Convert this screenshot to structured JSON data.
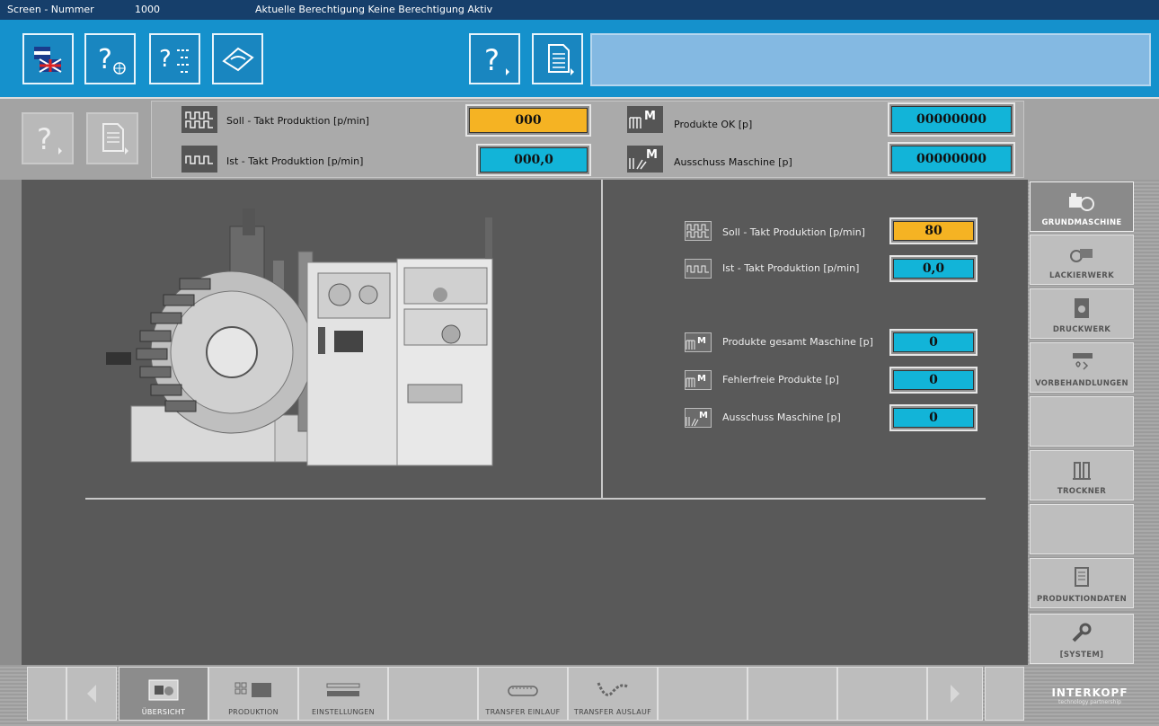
{
  "titlebar": {
    "screen_label": "Screen - Nummer",
    "screen_number": "1000",
    "auth_text": "Aktuelle Berechtigung Keine Berechtigung Aktiv"
  },
  "status": {
    "soll_label": "Soll - Takt Produktion [p/min]",
    "soll_value": "000",
    "ist_label": "Ist - Takt Produktion [p/min]",
    "ist_value": "000,0",
    "ok_label": "Produkte OK [p]",
    "ok_value": "00000000",
    "ausschuss_label": "Ausschuss Maschine [p]",
    "ausschuss_value": "00000000"
  },
  "machine_panel": {
    "soll_label": "Soll - Takt Produktion [p/min]",
    "soll_value": "80",
    "ist_label": "Ist - Takt Produktion [p/min]",
    "ist_value": "0,0",
    "gesamt_label": "Produkte gesamt Maschine [p]",
    "gesamt_value": "0",
    "fehlerfrei_label": "Fehlerfreie Produkte [p]",
    "fehlerfrei_value": "0",
    "ausschuss_label": "Ausschuss Maschine [p]",
    "ausschuss_value": "0"
  },
  "sidenav": [
    {
      "label": "GRUNDMASCHINE",
      "icon": "machine-icon",
      "active": true
    },
    {
      "label": "LACKIERWERK",
      "icon": "coating-icon"
    },
    {
      "label": "DRUCKWERK",
      "icon": "print-icon"
    },
    {
      "label": "VORBEHANDLUNGEN",
      "icon": "pretreatment-icon"
    },
    {
      "label": "",
      "icon": ""
    },
    {
      "label": "TROCKNER",
      "icon": "dryer-icon"
    },
    {
      "label": "",
      "icon": ""
    },
    {
      "label": "PRODUKTIONDATEN",
      "icon": "document-icon"
    },
    {
      "label": "[SYSTEM]",
      "icon": "wrench-icon"
    }
  ],
  "bottomnav": [
    {
      "label": "ÜBERSICHT",
      "icon": "overview-icon",
      "active": true
    },
    {
      "label": "PRODUKTION",
      "icon": "production-icon"
    },
    {
      "label": "EINSTELLUNGEN",
      "icon": "settings-icon"
    },
    {
      "label": "",
      "icon": ""
    },
    {
      "label": "TRANSFER EINLAUF",
      "icon": "transfer-in-icon"
    },
    {
      "label": "TRANSFER AUSLAUF",
      "icon": "transfer-out-icon"
    }
  ],
  "logo": {
    "name": "INTERKOPF",
    "tagline": "technology partnership"
  },
  "colors": {
    "toolbar": "#1591cc",
    "titlebar": "#163f6b",
    "setpoint": "#f5b323",
    "actual": "#12b4d8"
  }
}
